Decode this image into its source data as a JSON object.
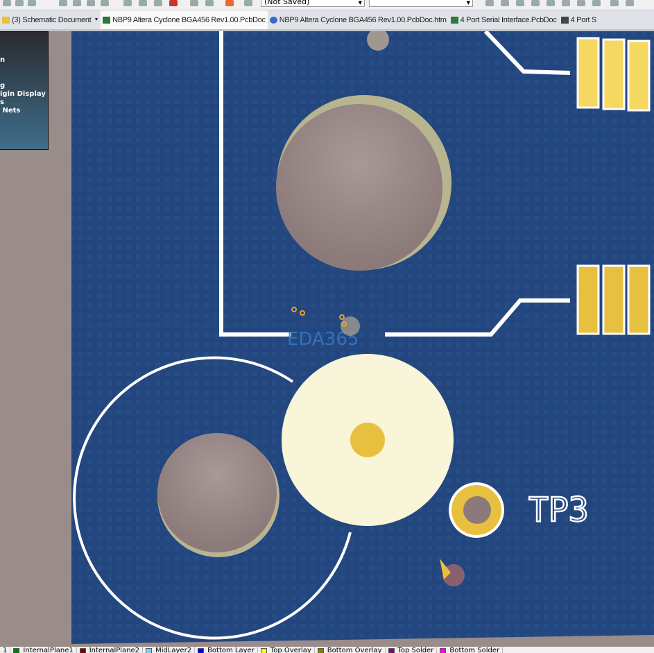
{
  "toolbar": {
    "variant_combo": "(Not Saved)",
    "second_combo": ""
  },
  "tabs": [
    {
      "label": "(3) Schematic Document",
      "icon": "schematic-icon",
      "active": false
    },
    {
      "label": "NBP9 Altera Cyclone BGA456 Rev1.00.PcbDoc",
      "icon": "pcb-icon",
      "active": true
    },
    {
      "label": "NBP9 Altera Cyclone BGA456 Rev1.00.PcbDoc.htm",
      "icon": "browser-icon",
      "active": false
    },
    {
      "label": "4 Port Serial Interface.PcbDoc",
      "icon": "pcb-icon",
      "active": false
    },
    {
      "label": "4 Port S",
      "icon": "library-icon",
      "active": false
    }
  ],
  "panel": {
    "lines": [
      "n",
      "g",
      "igin Display",
      "s",
      " Nets"
    ]
  },
  "pcb": {
    "designator": "TP3",
    "watermark": "EDA365"
  },
  "layers": [
    {
      "label": "1",
      "color": ""
    },
    {
      "label": "InternalPlane1",
      "color": "#008000"
    },
    {
      "label": "InternalPlane2",
      "color": "#800000"
    },
    {
      "label": "MidLayer2",
      "color": "#80d0f0"
    },
    {
      "label": "Bottom Layer",
      "color": "#0000ff"
    },
    {
      "label": "Top Overlay",
      "color": "#ffff00"
    },
    {
      "label": "Bottom Overlay",
      "color": "#808000"
    },
    {
      "label": "Top Solder",
      "color": "#800080"
    },
    {
      "label": "Bottom Solder",
      "color": "#ff00ff"
    }
  ]
}
